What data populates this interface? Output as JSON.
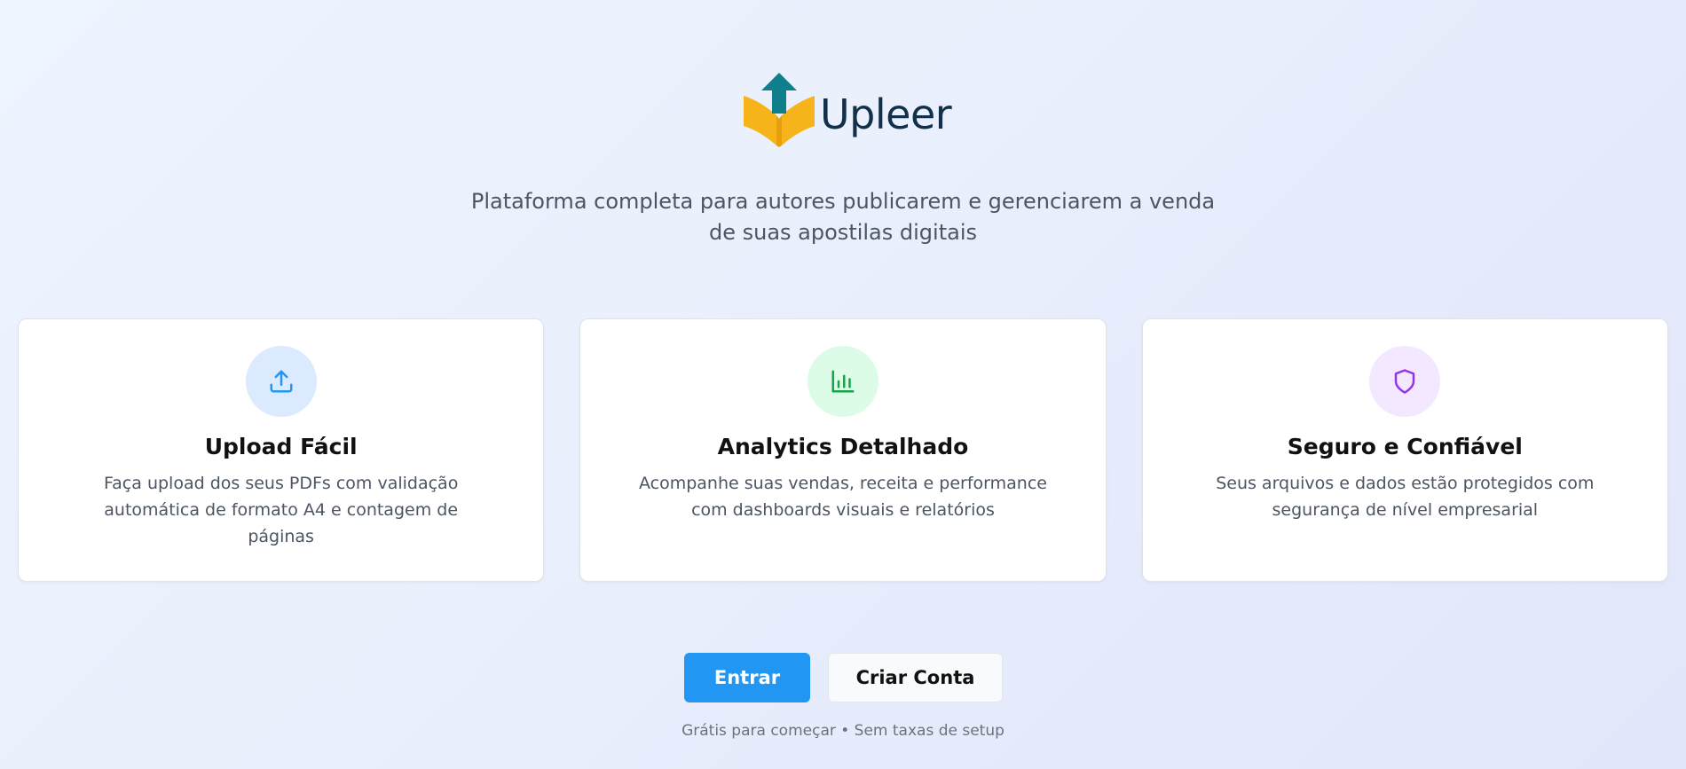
{
  "logo": {
    "name": "Upleer"
  },
  "tagline": "Plataforma completa para autores publicarem e gerenciarem a venda de suas apostilas digitais",
  "features": [
    {
      "title": "Upload Fácil",
      "description": "Faça upload dos seus PDFs com validação automática de formato A4 e contagem de páginas",
      "icon": "upload-icon",
      "color": "#2196f3",
      "bg": "#dbeafe"
    },
    {
      "title": "Analytics Detalhado",
      "description": "Acompanhe suas vendas, receita e performance com dashboards visuais e relatórios",
      "icon": "bar-chart-icon",
      "color": "#16a34a",
      "bg": "#dcfce7"
    },
    {
      "title": "Seguro e Confiável",
      "description": "Seus arquivos e dados estão protegidos com segurança de nível empresarial",
      "icon": "shield-icon",
      "color": "#9333ea",
      "bg": "#f3e8ff"
    }
  ],
  "actions": {
    "login_label": "Entrar",
    "signup_label": "Criar Conta",
    "primary_color": "#2196f3"
  },
  "footnote": "Grátis para começar • Sem taxas de setup",
  "colors": {
    "logo_book": "#f6b41a",
    "logo_arrow": "#0f7f8c",
    "logo_text": "#13304a"
  }
}
